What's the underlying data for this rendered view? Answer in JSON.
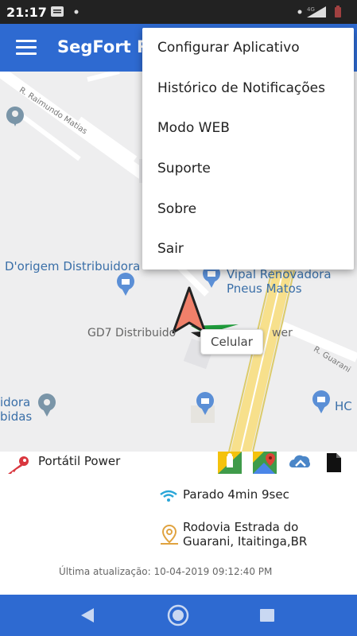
{
  "status_bar": {
    "time": "21:17",
    "network": "4G"
  },
  "app_bar": {
    "title": "SegFort R"
  },
  "map": {
    "labels": {
      "dorigem": "D'origem Distribuidora",
      "vipal_line1": "Vipal Renovadora",
      "vipal_line2": "Pneus Matos",
      "gd7": "GD7 Distribuido",
      "power_partial": "wer",
      "idora": "idora",
      "bidas": "bidas",
      "hc": "HC",
      "street_raimundo": "R. Raimundo Matias",
      "street_guarani": "R. Guarani"
    },
    "popup_label": "Celular"
  },
  "menu": {
    "items": [
      "Configurar Aplicativo",
      "Histórico de Notificações",
      "Modo WEB",
      "Suporte",
      "Sobre",
      "Sair"
    ]
  },
  "info": {
    "device_name": "Portátil Power",
    "status": "Parado 4min 9sec",
    "address": "Rodovia Estrada do Guarani, Itaitinga,BR",
    "last_update": "Última atualização: 10-04-2019 09:12:40 PM"
  },
  "colors": {
    "primary": "#2e6ad1",
    "marker_arrow": "#f0806a",
    "key_icon": "#d9363e",
    "road_yellow": "#f7e08c"
  },
  "icons": {
    "key": "key-icon",
    "street_view": "street-view-icon",
    "google_maps": "google-maps-icon",
    "share": "share-icon",
    "document": "document-icon",
    "wifi": "wifi-signal-icon",
    "location": "location-pin-icon"
  }
}
